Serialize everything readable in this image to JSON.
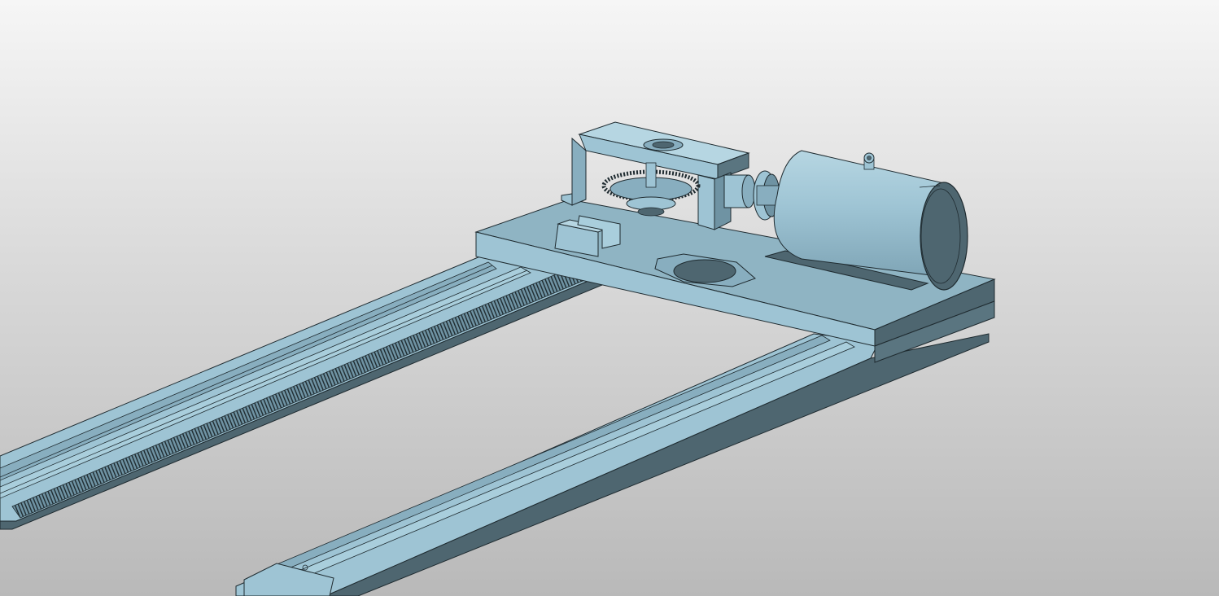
{
  "viewport": {
    "background_top": "#f6f6f6",
    "background_bottom": "#b9b9b9"
  },
  "model": {
    "face_color_light": "#9ec4d4",
    "face_color_mid": "#88aebf",
    "face_color_dark": "#4e6670",
    "edge_color": "#1f2b30",
    "parts": [
      "left-rail",
      "right-rail",
      "gear-rack",
      "carriage-plate",
      "gearbox-housing",
      "bevel-gear",
      "coupling",
      "electric-motor",
      "lifting-eye",
      "clamp-blocks",
      "mounting-cutout"
    ]
  }
}
